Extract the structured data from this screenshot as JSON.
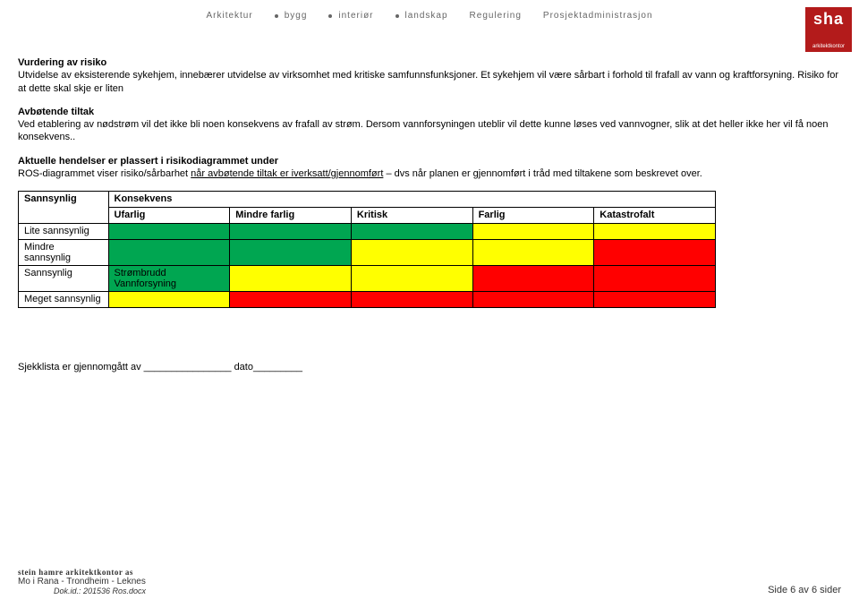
{
  "header": {
    "items": [
      "Arkitektur",
      "bygg",
      "interiør",
      "landskap",
      "Regulering",
      "Prosjektadministrasjon"
    ]
  },
  "logo": {
    "top": "sha",
    "bottom": "arkitektkontor"
  },
  "section1": {
    "title": "Vurdering av risiko",
    "body": "Utvidelse av eksisterende sykehjem, innebærer utvidelse av virksomhet med kritiske samfunnsfunksjoner. Et sykehjem vil være sårbart i forhold til frafall av vann og kraftforsyning. Risiko for at dette skal skje er liten"
  },
  "section2": {
    "title": "Avbøtende tiltak",
    "body": "Ved etablering av nødstrøm vil det ikke bli noen konsekvens av frafall av strøm. Dersom vannforsyningen uteblir vil dette kunne løses ved vannvogner, slik at det heller ikke her vil få noen konsekvens.."
  },
  "section3": {
    "title": "Aktuelle hendelser er plassert i risikodiagrammet under",
    "body_pre": "ROS-diagrammet viser risiko/sårbarhet ",
    "body_under": "når avbøtende tiltak er iverksatt/gjennomført",
    "body_post": " – dvs når planen er gjennomført i tråd med tiltakene som beskrevet over."
  },
  "table": {
    "prob_header": "Sannsynlig",
    "cons_header": "Konsekvens",
    "cons_cols": [
      "Ufarlig",
      "Mindre farlig",
      "Kritisk",
      "Farlig",
      "Katastrofalt"
    ],
    "rows": [
      {
        "label": "Lite sannsynlig",
        "cells": [
          "green",
          "green",
          "green",
          "yellow",
          "yellow"
        ],
        "text": [
          "",
          "",
          "",
          "",
          ""
        ]
      },
      {
        "label": "Mindre sannsynlig",
        "cells": [
          "green",
          "green",
          "yellow",
          "yellow",
          "red"
        ],
        "text": [
          "",
          "",
          "",
          "",
          ""
        ]
      },
      {
        "label": "Sannsynlig",
        "cells": [
          "green",
          "yellow",
          "yellow",
          "red",
          "red"
        ],
        "text": [
          "Strømbrudd\nVannforsyning",
          "",
          "",
          "",
          ""
        ]
      },
      {
        "label": "Meget sannsynlig",
        "cells": [
          "yellow",
          "red",
          "red",
          "red",
          "red"
        ],
        "text": [
          "",
          "",
          "",
          "",
          ""
        ]
      }
    ]
  },
  "signoff": "Sjekklista er gjennomgått av ________________ dato_________",
  "footer": {
    "company": "stein hamre arkitektkontor as",
    "locations": "Mo i Rana   -   Trondheim   -   Leknes",
    "dok": "Dok.id.:  201536 Ros.docx",
    "page": "Side 6 av 6 sider"
  }
}
